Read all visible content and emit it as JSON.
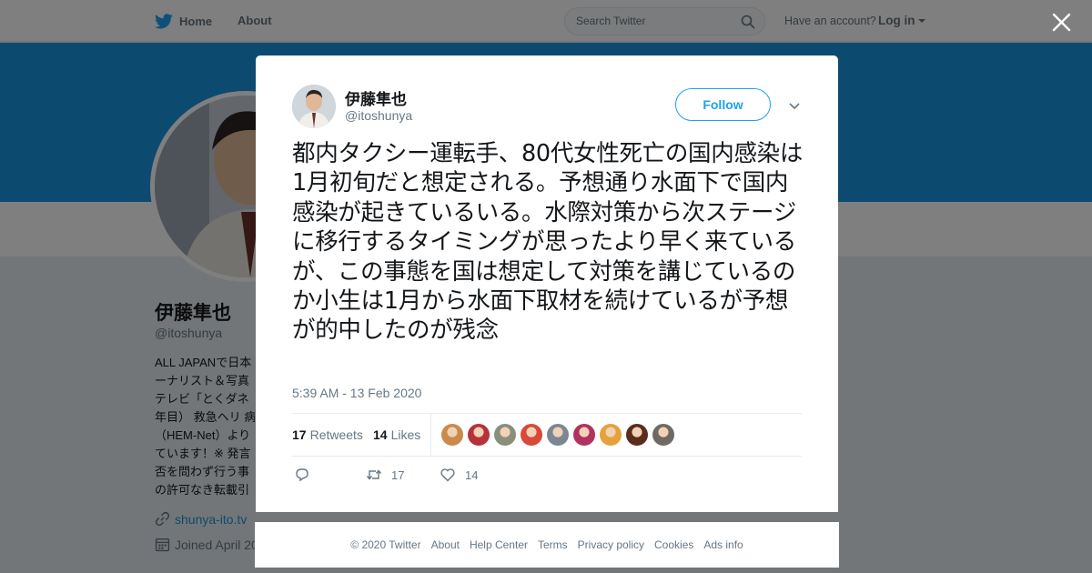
{
  "nav": {
    "home_label": "Home",
    "about_label": "About",
    "search_placeholder": "Search Twitter",
    "have_account": "Have an account?",
    "login_label": "Log in"
  },
  "profile": {
    "name": "伊藤隼也",
    "handle": "@itoshunya",
    "bio": "ALL JAPANで日本\nーナリスト＆写真\nテレビ「とくダネ\n年目） 救急ヘリ 病\n（HEM-Net）より\nています！※ 発言\n否を問わず行う事\nの許可なき転載引",
    "link": "shunya-ito.tv",
    "joined": "Joined April 20"
  },
  "tweet": {
    "author_name": "伊藤隼也",
    "author_handle": "@itoshunya",
    "follow_label": "Follow",
    "text": "都内タクシー運転手、80代女性死亡の国内感染は1月初旬だと想定される。予想通り水面下で国内感染が起きているいる。水際対策から次ステージに移行するタイミングが思ったより早く来ているが、この事態を国は想定して対策を講じているのか小生は1月から水面下取材を続けているが予想が的中したのが残念",
    "timestamp": "5:39 AM - 13 Feb 2020",
    "retweets_count": "17",
    "retweets_label": "Retweets",
    "likes_count": "14",
    "likes_label": "Likes",
    "action_retweet_count": "17",
    "action_like_count": "14"
  },
  "likers": [
    {
      "icon": "liker-avatar-1",
      "color": "#c98a4b"
    },
    {
      "icon": "liker-avatar-2",
      "color": "#b8303a"
    },
    {
      "icon": "liker-avatar-3",
      "color": "#8a8f7c"
    },
    {
      "icon": "liker-avatar-4",
      "color": "#d9493a"
    },
    {
      "icon": "liker-avatar-5",
      "color": "#7c8794"
    },
    {
      "icon": "liker-avatar-6",
      "color": "#b2325f"
    },
    {
      "icon": "liker-avatar-7",
      "color": "#e3a23b"
    },
    {
      "icon": "liker-avatar-8",
      "color": "#5a2d1c"
    },
    {
      "icon": "liker-avatar-9",
      "color": "#6f6a61"
    }
  ],
  "footer": {
    "links": [
      "© 2020 Twitter",
      "About",
      "Help Center",
      "Terms",
      "Privacy policy",
      "Cookies",
      "Ads info"
    ]
  },
  "colors": {
    "accent": "#1da1f2",
    "banner": "#1b95e0",
    "text_secondary": "#657786"
  }
}
